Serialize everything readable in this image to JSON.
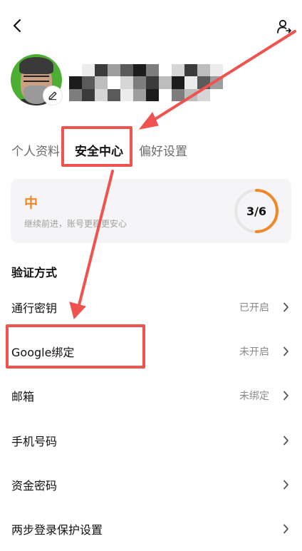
{
  "header": {
    "back_icon": "chevron-left-icon",
    "account_icon": "user-switch-icon"
  },
  "profile": {
    "avatar_icon": "avatar",
    "edit_icon": "pencil-icon"
  },
  "tabs": [
    {
      "label": "个人资料",
      "active": false
    },
    {
      "label": "安全中心",
      "active": true
    },
    {
      "label": "偏好设置",
      "active": false
    }
  ],
  "security_card": {
    "level": "中",
    "hint": "继续前进，账号更稳更安心",
    "progress_text": "3/6",
    "progress_fraction": 0.5,
    "accent_color": "#f0882a",
    "track_color": "#e6e6e6"
  },
  "section": {
    "title": "验证方式"
  },
  "rows": [
    {
      "label": "通行密钥",
      "status": "已开启"
    },
    {
      "label": "Google绑定",
      "status": "未开启"
    },
    {
      "label": "邮箱",
      "status": "未绑定"
    },
    {
      "label": "手机号码",
      "status": ""
    },
    {
      "label": "资金密码",
      "status": ""
    },
    {
      "label": "两步登录保护设置",
      "status": ""
    }
  ],
  "annotation_color": "#ef5350"
}
